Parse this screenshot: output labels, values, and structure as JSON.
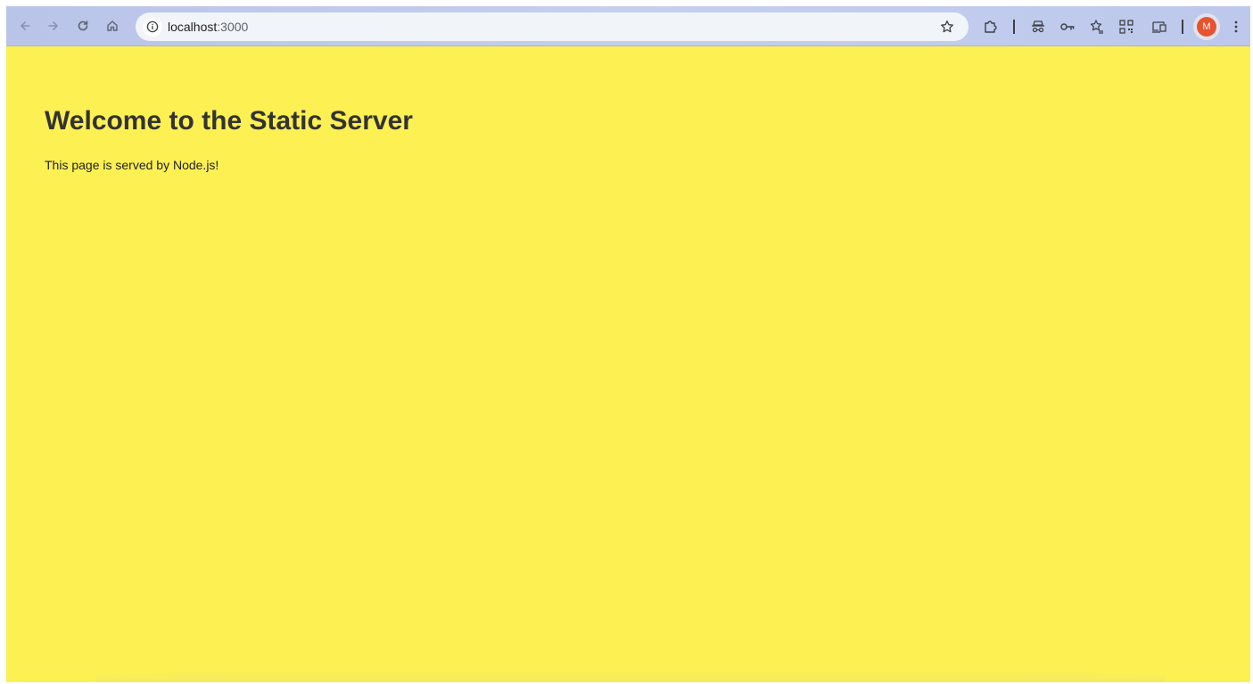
{
  "browser": {
    "address_bar": {
      "host": "localhost",
      "port": ":3000"
    },
    "icons": {
      "back": "arrow-left-icon",
      "forward": "arrow-right-icon",
      "reload": "reload-icon",
      "home": "home-icon",
      "site_info": "info-icon",
      "bookmark": "star-icon",
      "extensions": "puzzle-icon",
      "incognito": "incognito-icon",
      "passwords": "key-icon",
      "bookmarks_panel": "star-list-icon",
      "qr_code": "qr-code-icon",
      "cast": "cast-icon",
      "menu": "kebab-menu-icon"
    },
    "profile": {
      "initial": "M",
      "color": "#e8522f"
    },
    "colors": {
      "toolbar": "#c4cfee",
      "omnibox": "#f1f4f9"
    }
  },
  "page": {
    "title": "Welcome to the Static Server",
    "text": "This page is served by Node.js!",
    "background_color": "#fdf053",
    "title_color": "#333333"
  }
}
